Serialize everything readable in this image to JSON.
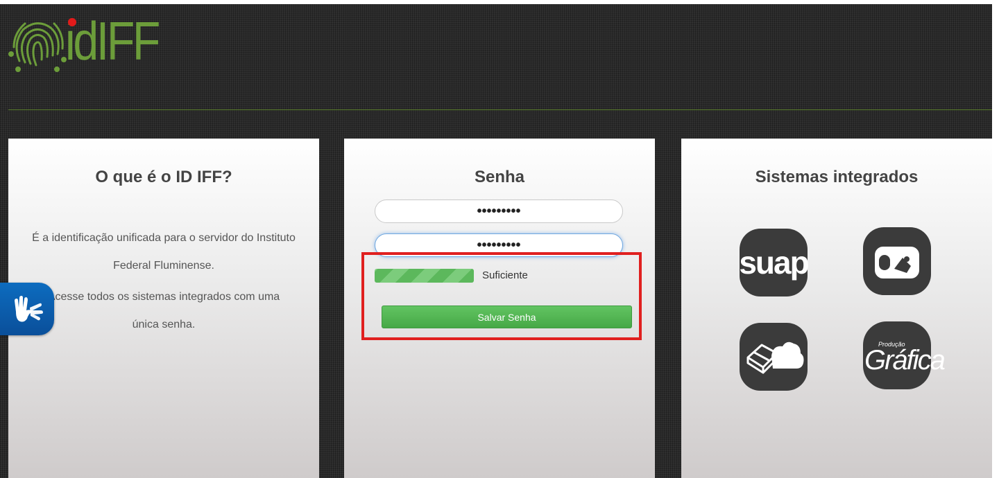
{
  "header": {
    "logo_text": "idIFF"
  },
  "about": {
    "title": "O que é o ID IFF?",
    "description_1": "É a identificação unificada para o servidor do Instituto Federal Fluminense.",
    "description_2": "Acesse todos os sistemas integrados com uma única senha."
  },
  "password": {
    "title": "Senha",
    "new_password_value": "•••••••••",
    "confirm_password_value": "•••••••••",
    "strength_label": "Suficiente",
    "strength_level": 1.0,
    "save_label": "Salvar Senha"
  },
  "systems": {
    "title": "Sistemas integrados",
    "items": [
      {
        "name": "suap",
        "label": "suap"
      },
      {
        "name": "mug-icon"
      },
      {
        "name": "cloud-box-icon"
      },
      {
        "name": "grafica",
        "label": "Gráfica",
        "sublabel": "Produção"
      }
    ]
  },
  "accessibility": {
    "icon": "sign-language-hands-icon"
  },
  "colors": {
    "brand_green": "#6c9d3a",
    "logo_dot": "#e21a1a",
    "save_button": "#5cb85c",
    "highlight_border": "#e0201f",
    "vlibras_blue": "#0d6cbf"
  }
}
